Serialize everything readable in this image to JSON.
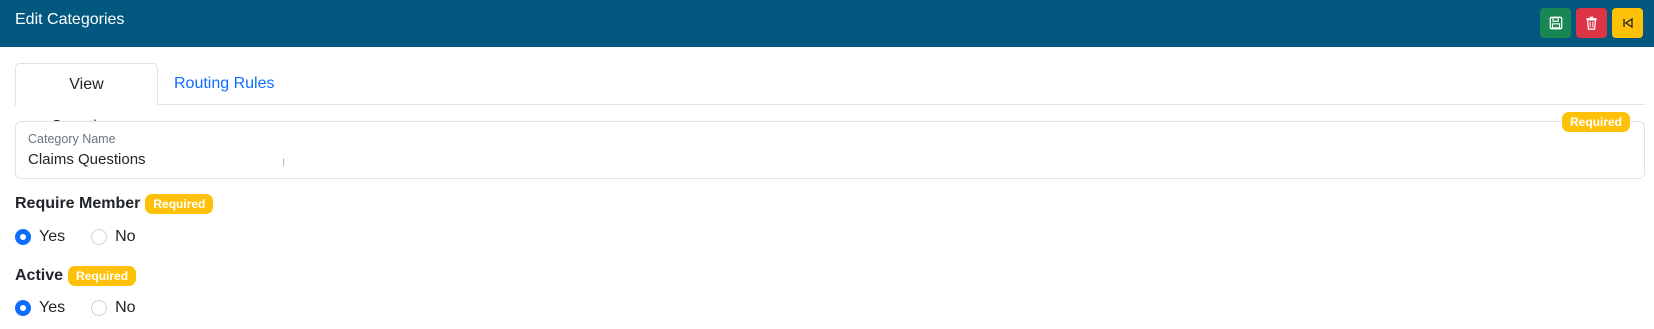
{
  "header": {
    "title": "Edit Categories",
    "buttons": {
      "save_icon": "floppy-disk-icon",
      "delete_icon": "trash-icon",
      "back_icon": "back-arrow-icon"
    },
    "colors": {
      "bar": "#03587f",
      "save": "#198754",
      "delete": "#dc3545",
      "back": "#ffc107"
    }
  },
  "tabs": [
    {
      "label": "View Questions",
      "active": true
    },
    {
      "label": "Routing Rules",
      "active": false
    }
  ],
  "category_name": {
    "label": "Category Name",
    "value": "Claims Questions",
    "badge": "Required"
  },
  "require_member": {
    "label": "Require Member",
    "badge": "Required",
    "options": [
      {
        "label": "Yes",
        "checked": true
      },
      {
        "label": "No",
        "checked": false
      }
    ]
  },
  "active": {
    "label": "Active",
    "badge": "Required",
    "options": [
      {
        "label": "Yes",
        "checked": true
      },
      {
        "label": "No",
        "checked": false
      }
    ]
  }
}
